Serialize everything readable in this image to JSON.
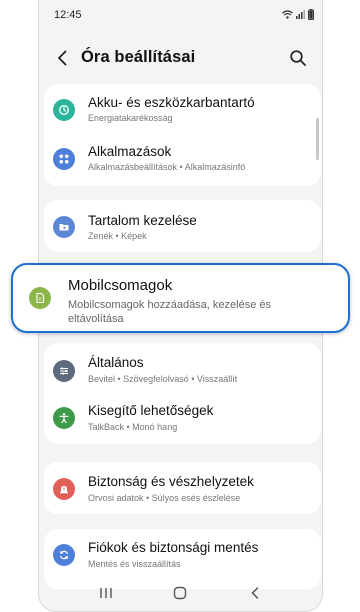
{
  "status_bar": {
    "time": "12:45"
  },
  "header": {
    "title": "Óra beállításai"
  },
  "groups": [
    {
      "items": [
        {
          "title": "Akku- és eszközkarbantartó",
          "subtitle": "Energiatakarékosság",
          "icon": "device-care-icon",
          "color": "#2bb49a"
        },
        {
          "title": "Alkalmazások",
          "subtitle": "Alkalmazásbeállítások • Alkalmazásinfó",
          "icon": "apps-icon",
          "color": "#4f7fd8"
        }
      ]
    },
    {
      "items": [
        {
          "title": "Tartalom kezelése",
          "subtitle": "Zenék • Képek",
          "icon": "content-folder-icon",
          "color": "#5a86d6"
        }
      ]
    },
    {
      "items": [
        {
          "title": "Általános",
          "subtitle": "Bevitel • Szövegfelolvasó • Visszaállít",
          "icon": "sliders-icon",
          "color": "#5b6b7d"
        },
        {
          "title": "Kisegítő lehetőségek",
          "subtitle": "TalkBack • Monó hang",
          "icon": "accessibility-icon",
          "color": "#3d9a48"
        }
      ]
    },
    {
      "items": [
        {
          "title": "Biztonság és vészhelyzetek",
          "subtitle": "Orvosi adatok • Súlyos esés észlelése",
          "icon": "emergency-icon",
          "color": "#e0605a"
        }
      ]
    },
    {
      "items": [
        {
          "title": "Fiókok és biztonsági mentés",
          "subtitle": "Mentés és visszaállítás",
          "icon": "sync-icon",
          "color": "#4f7fd8"
        }
      ]
    }
  ],
  "highlighted": {
    "title": "Mobilcsomagok",
    "subtitle": "Mobilcsomagok hozzáadása, kezelése és eltávolítása",
    "icon": "esim-icon",
    "color": "#8cb54a",
    "border_color": "#1e6fd0"
  }
}
